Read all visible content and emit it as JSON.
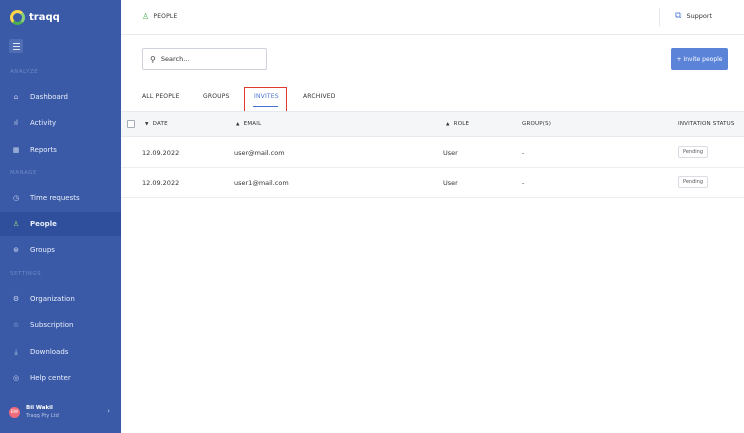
{
  "sidebar": {
    "brand": "traqq",
    "sections": {
      "analyze": "ANALYZE",
      "manage": "MANAGE",
      "settings": "SETTINGS"
    },
    "items": [
      {
        "label": "Dashboard",
        "icon": "home-icon"
      },
      {
        "label": "Activity",
        "icon": "bar-chart-icon"
      },
      {
        "label": "Reports",
        "icon": "reports-icon"
      },
      {
        "label": "Time requests",
        "icon": "clock-icon"
      },
      {
        "label": "People",
        "icon": "people-icon"
      },
      {
        "label": "Groups",
        "icon": "groups-icon"
      },
      {
        "label": "Organization",
        "icon": "organization-icon"
      },
      {
        "label": "Subscription",
        "icon": "subscription-icon"
      },
      {
        "label": "Downloads",
        "icon": "download-icon"
      },
      {
        "label": "Help center",
        "icon": "help-icon"
      }
    ],
    "active_item": "People",
    "user": {
      "initials": "BW",
      "name": "Bil Wakil",
      "company": "Traqq Pty Ltd"
    }
  },
  "header": {
    "title": "PEOPLE",
    "support_label": "Support"
  },
  "search": {
    "placeholder": "Search..."
  },
  "invite_button": "+ Invite people",
  "tabs": [
    {
      "label": "ALL PEOPLE"
    },
    {
      "label": "GROUPS"
    },
    {
      "label": "INVITES",
      "active": true
    },
    {
      "label": "ARCHIVED"
    }
  ],
  "table": {
    "columns": [
      "DATE",
      "EMAIL",
      "ROLE",
      "GROUP(S)",
      "INVITATION STATUS"
    ],
    "rows": [
      {
        "date": "12.09.2022",
        "email": "user@mail.com",
        "role": "User",
        "groups": "-",
        "status": "Pending"
      },
      {
        "date": "12.09.2022",
        "email": "user1@mail.com",
        "role": "User",
        "groups": "-",
        "status": "Pending"
      }
    ]
  },
  "colors": {
    "sidebar": "#3a5aa8",
    "accent": "#5b84d9",
    "active_tab": "#4a74cf",
    "highlight": "#e0392f"
  }
}
